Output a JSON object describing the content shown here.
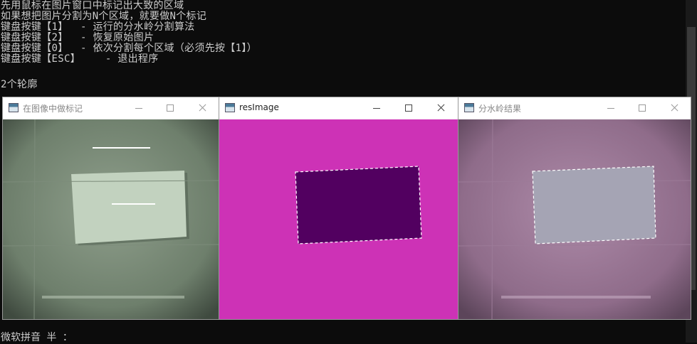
{
  "console": {
    "lines": [
      "先用鼠标在图片窗口中标记出大致的区域",
      "如果想把图片分割为N个区域，就要做N个标记",
      "键盘按键【1】  - 运行的分水岭分割算法",
      "键盘按键【2】  - 恢复原始图片",
      "键盘按键【0】  - 依次分割每个区域（必须先按【1】）",
      "键盘按键【ESC】    - 退出程序",
      "",
      "2个轮廓"
    ],
    "ime_status": "微软拼音 半 ："
  },
  "windows": [
    {
      "title": "在图像中做标记",
      "active": false,
      "image": "marked-source-image"
    },
    {
      "title": "resImage",
      "active": true,
      "image": "segmentation-mask"
    },
    {
      "title": "分水岭结果",
      "active": false,
      "image": "watershed-result-overlay"
    }
  ],
  "colors": {
    "mask_background": "#cd32b6",
    "mask_region": "#520060",
    "marker": "#ffffff"
  },
  "icons": [
    "window-app-icon",
    "minimize-icon",
    "maximize-icon",
    "close-icon"
  ]
}
